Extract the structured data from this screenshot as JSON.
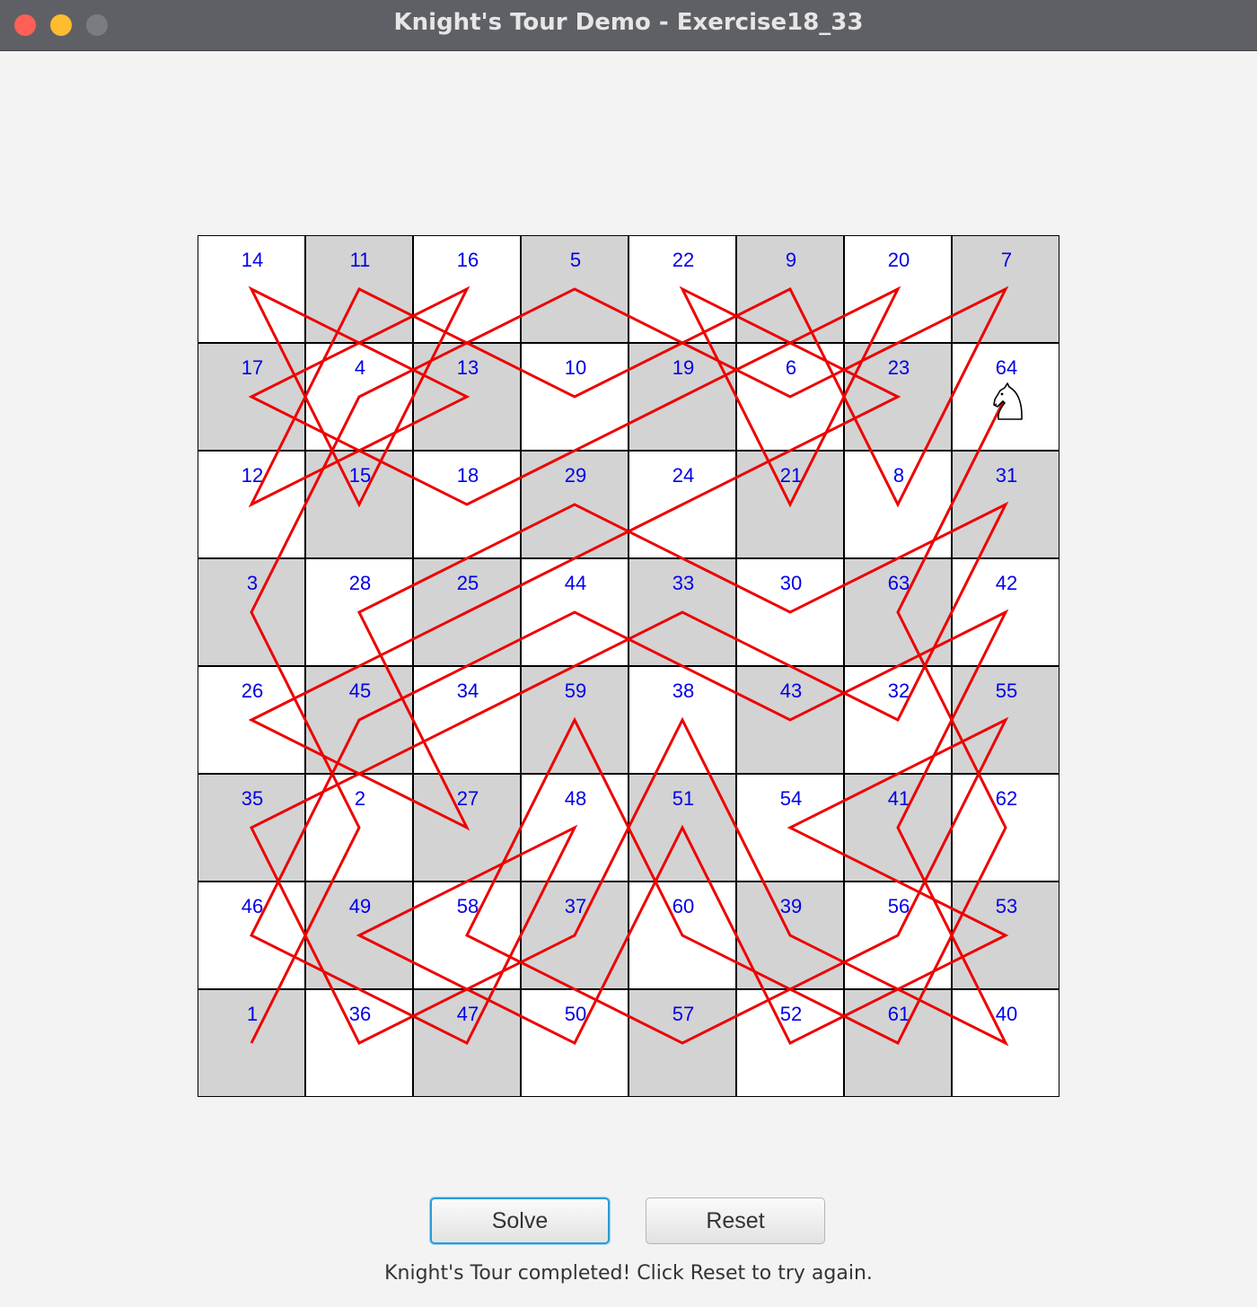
{
  "window": {
    "title": "Knight's Tour Demo - Exercise18_33"
  },
  "board": {
    "rows": [
      [
        14,
        11,
        16,
        5,
        22,
        9,
        20,
        7
      ],
      [
        17,
        4,
        13,
        10,
        19,
        6,
        23,
        64
      ],
      [
        12,
        15,
        18,
        29,
        24,
        21,
        8,
        31
      ],
      [
        3,
        28,
        25,
        44,
        33,
        30,
        63,
        42
      ],
      [
        26,
        45,
        34,
        59,
        38,
        43,
        32,
        55
      ],
      [
        35,
        2,
        27,
        48,
        51,
        54,
        41,
        62
      ],
      [
        46,
        49,
        58,
        37,
        60,
        39,
        56,
        53
      ],
      [
        1,
        36,
        47,
        50,
        57,
        52,
        61,
        40
      ]
    ],
    "light_color": "#ffffff",
    "dark_color": "#d3d3d3",
    "number_color": "#0000e6",
    "path_color": "#ee0000",
    "knight_icon": "chess-knight-icon"
  },
  "buttons": {
    "solve_label": "Solve",
    "reset_label": "Reset"
  },
  "status": {
    "message": "Knight's Tour completed! Click Reset to try again."
  }
}
